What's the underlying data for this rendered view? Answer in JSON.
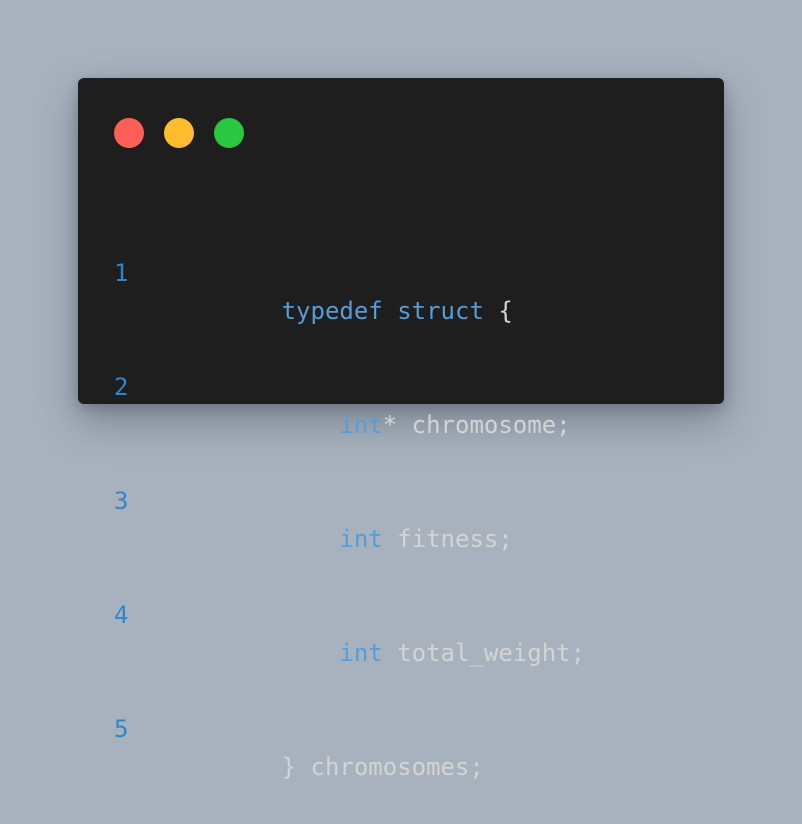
{
  "window": {
    "controls": [
      {
        "name": "close",
        "color": "#ff5f57"
      },
      {
        "name": "minimize",
        "color": "#febc2e"
      },
      {
        "name": "maximize",
        "color": "#28c840"
      }
    ]
  },
  "code": {
    "language": "c",
    "colors": {
      "keyword": "#569cd6",
      "text": "#d4d4d4",
      "line_number": "#2f86c8",
      "background": "#1e1e1e",
      "page_background": "#a7b2be"
    },
    "lines": [
      {
        "number": "1",
        "tokens": [
          {
            "text": "typedef",
            "kind": "keyword"
          },
          {
            "text": " ",
            "kind": "text"
          },
          {
            "text": "struct",
            "kind": "keyword"
          },
          {
            "text": " {",
            "kind": "text"
          }
        ]
      },
      {
        "number": "2",
        "tokens": [
          {
            "text": "    ",
            "kind": "text"
          },
          {
            "text": "int",
            "kind": "keyword"
          },
          {
            "text": "* chromosome;",
            "kind": "text"
          }
        ]
      },
      {
        "number": "3",
        "tokens": [
          {
            "text": "    ",
            "kind": "text"
          },
          {
            "text": "int",
            "kind": "keyword"
          },
          {
            "text": " fitness;",
            "kind": "text"
          }
        ]
      },
      {
        "number": "4",
        "tokens": [
          {
            "text": "    ",
            "kind": "text"
          },
          {
            "text": "int",
            "kind": "keyword"
          },
          {
            "text": " total_weight;",
            "kind": "text"
          }
        ]
      },
      {
        "number": "5",
        "tokens": [
          {
            "text": "} chromosomes;",
            "kind": "text"
          }
        ]
      }
    ]
  }
}
